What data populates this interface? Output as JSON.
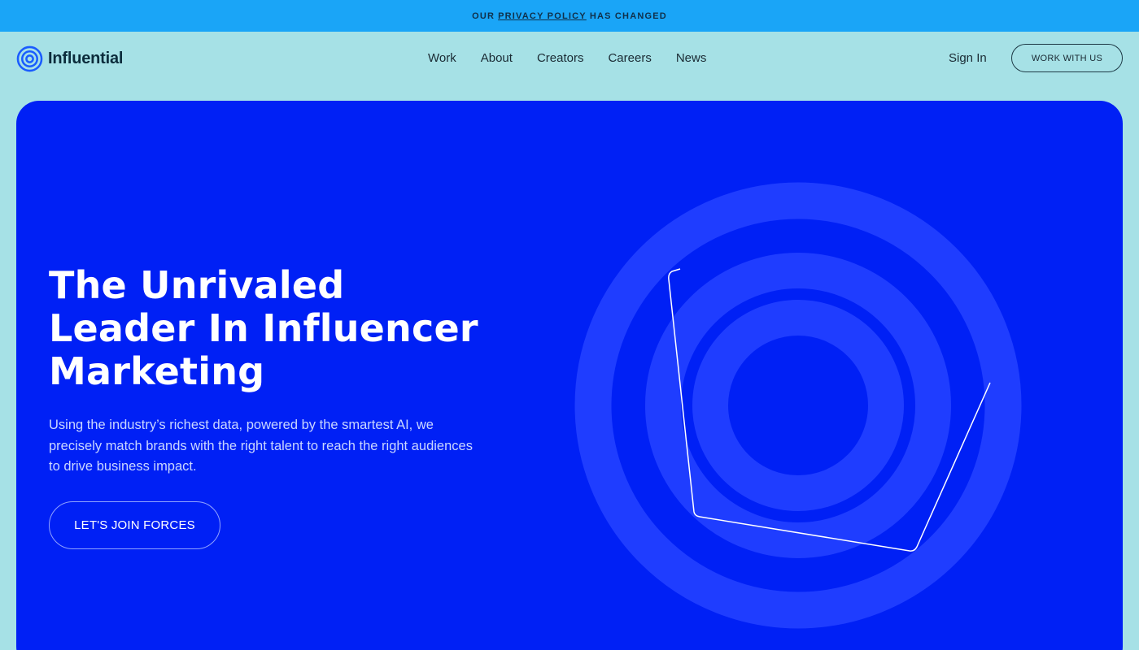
{
  "banner": {
    "prefix": "OUR",
    "link": "PRIVACY POLICY",
    "suffix": "HAS CHANGED"
  },
  "header": {
    "logo_text": "Influential",
    "nav": [
      "Work",
      "About",
      "Creators",
      "Careers",
      "News"
    ],
    "sign_in": "Sign In",
    "cta": "WORK WITH US"
  },
  "hero": {
    "title_lines": [
      "The Unrivaled",
      "Leader In Influencer",
      "Marketing"
    ],
    "description": "Using the industry’s richest data, powered by the smartest AI, we precisely match brands with the right talent to reach the right audiences to drive business impact.",
    "button": "LET'S JOIN FORCES"
  },
  "colors": {
    "page_bg": "#a6e1e6",
    "banner_bg": "#1aa5f7",
    "hero_bg": "#0020f5",
    "ring": "#1f3dff",
    "logo_blue": "#1a5cff"
  },
  "icons": {
    "logo": "concentric-circles-logo-icon"
  }
}
